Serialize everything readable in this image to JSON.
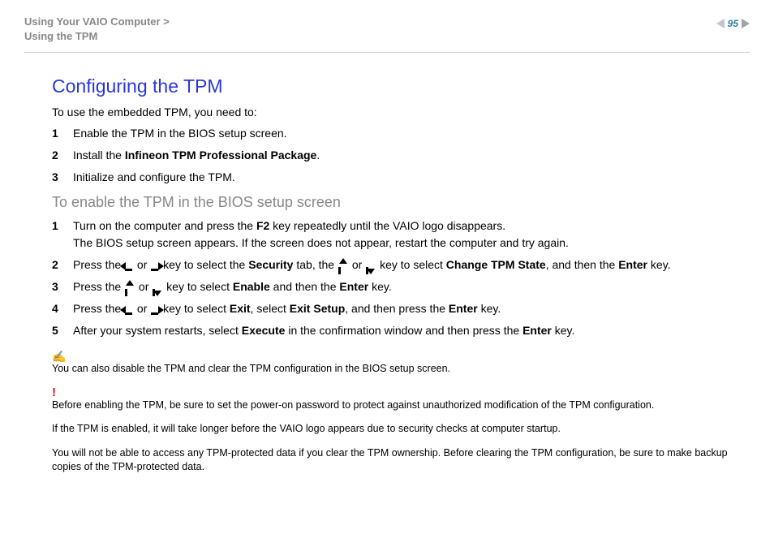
{
  "header": {
    "breadcrumb_line1": "Using Your VAIO Computer >",
    "breadcrumb_line2": "Using the TPM",
    "page_number": "95"
  },
  "title": "Configuring the TPM",
  "intro": "To use the embedded TPM, you need to:",
  "list1": {
    "i1": "Enable the TPM in the BIOS setup screen.",
    "i2a": "Install the ",
    "i2b": "Infineon TPM Professional Package",
    "i2c": ".",
    "i3": "Initialize and configure the TPM."
  },
  "subheading": "To enable the TPM in the BIOS setup screen",
  "list2": {
    "s1a": "Turn on the computer and press the ",
    "s1b": "F2",
    "s1c": " key repeatedly until the VAIO logo disappears.",
    "s1d": "The BIOS setup screen appears. If the screen does not appear, restart the computer and try again.",
    "s2a": "Press the ",
    "s2b": " or ",
    "s2c": " key to select the ",
    "s2d": "Security",
    "s2e": " tab, the ",
    "s2f": " or ",
    "s2g": " key to select ",
    "s2h": "Change TPM State",
    "s2i": ", and then the ",
    "s2j": "Enter",
    "s2k": " key.",
    "s3a": "Press the ",
    "s3b": " or ",
    "s3c": " key to select ",
    "s3d": "Enable",
    "s3e": " and then the ",
    "s3f": "Enter",
    "s3g": " key.",
    "s4a": "Press the ",
    "s4b": " or ",
    "s4c": " key to select ",
    "s4d": "Exit",
    "s4e": ", select ",
    "s4f": "Exit Setup",
    "s4g": ", and then press the ",
    "s4h": "Enter",
    "s4i": " key.",
    "s5a": "After your system restarts, select ",
    "s5b": "Execute",
    "s5c": " in the confirmation window and then press the ",
    "s5d": "Enter",
    "s5e": " key."
  },
  "notes": {
    "n1": "You can also disable the TPM and clear the TPM configuration in the BIOS setup screen.",
    "n2": "Before enabling the TPM, be sure to set the power-on password to protect against unauthorized modification of the TPM configuration.",
    "n3": "If the TPM is enabled, it will take longer before the VAIO logo appears due to security checks at computer startup.",
    "n4": "You will not be able to access any TPM-protected data if you clear the TPM ownership. Before clearing the TPM configuration, be sure to make backup copies of the TPM-protected data."
  },
  "nums": {
    "n1": "1",
    "n2": "2",
    "n3": "3",
    "n4": "4",
    "n5": "5"
  },
  "icons": {
    "note": "✍",
    "warn": "!"
  }
}
